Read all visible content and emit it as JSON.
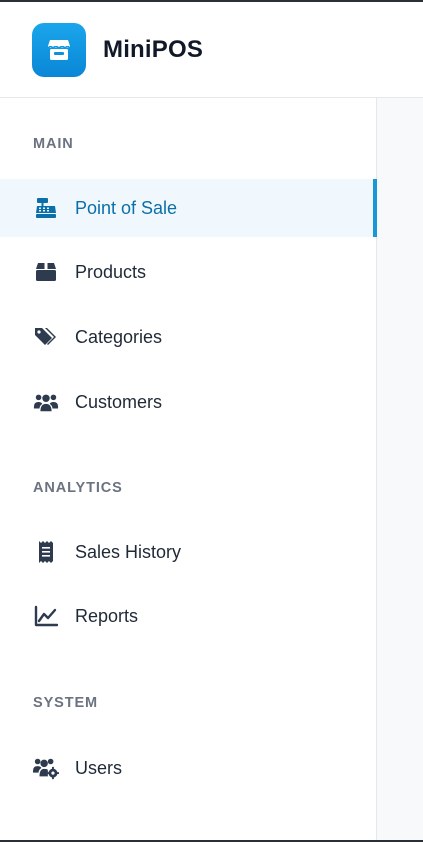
{
  "header": {
    "app_title": "MiniPOS",
    "logo_icon": "store-icon",
    "logo_color": "#0e8fe0"
  },
  "sidebar": {
    "sections": [
      {
        "label": "MAIN",
        "items": [
          {
            "label": "Point of Sale",
            "icon": "cash-register-icon",
            "active": true
          },
          {
            "label": "Products",
            "icon": "box-icon",
            "active": false
          },
          {
            "label": "Categories",
            "icon": "tags-icon",
            "active": false
          },
          {
            "label": "Customers",
            "icon": "users-icon",
            "active": false
          }
        ]
      },
      {
        "label": "ANALYTICS",
        "items": [
          {
            "label": "Sales History",
            "icon": "receipt-icon",
            "active": false
          },
          {
            "label": "Reports",
            "icon": "line-chart-icon",
            "active": false
          }
        ]
      },
      {
        "label": "SYSTEM",
        "items": [
          {
            "label": "Users",
            "icon": "users-cog-icon",
            "active": false
          }
        ]
      }
    ]
  },
  "colors": {
    "accent": "#1a97d8",
    "active_text": "#0b6fa8",
    "active_bg": "#f0f8fe",
    "section_label": "#6b7280",
    "icon": "#2e3a4e"
  }
}
